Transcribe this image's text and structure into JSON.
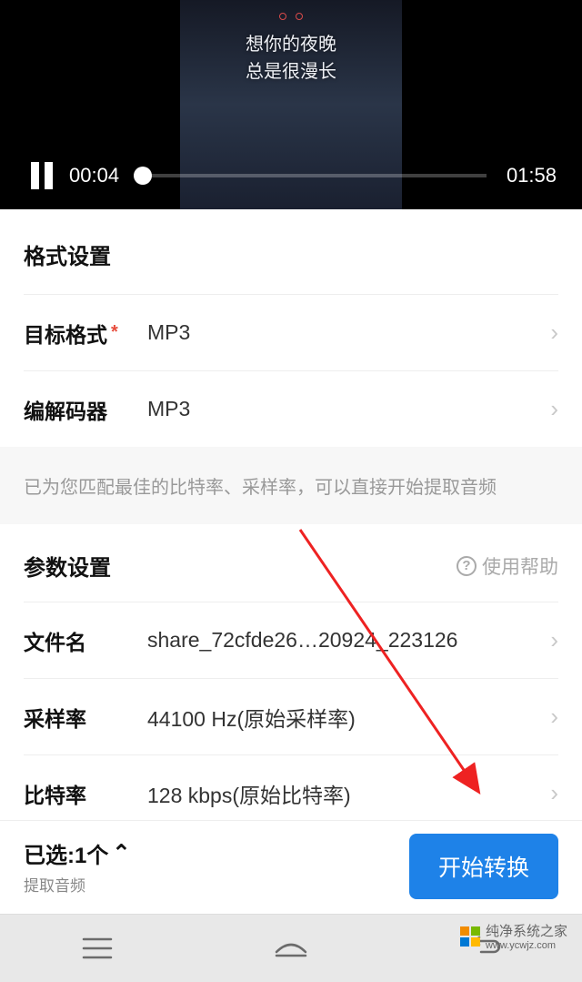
{
  "video": {
    "lyrics_line1": "想你的夜晚",
    "lyrics_line2": "总是很漫长",
    "current_time": "00:04",
    "duration": "01:58"
  },
  "format_section": {
    "title": "格式设置",
    "target_format": {
      "label": "目标格式",
      "value": "MP3",
      "required": true
    },
    "codec": {
      "label": "编解码器",
      "value": "MP3"
    }
  },
  "info_banner": "已为您匹配最佳的比特率、采样率，可以直接开始提取音频",
  "param_section": {
    "title": "参数设置",
    "help_label": "使用帮助",
    "filename": {
      "label": "文件名",
      "value": "share_72cfde26…20924_223126"
    },
    "sample_rate": {
      "label": "采样率",
      "value": "44100 Hz(原始采样率)"
    },
    "bitrate": {
      "label": "比特率",
      "value": "128 kbps(原始比特率)"
    }
  },
  "bottom": {
    "selected_label": "已选:1个",
    "sub_label": "提取音频",
    "convert_button": "开始转换"
  },
  "watermark": {
    "text": "纯净系统之家",
    "url": "www.ycwjz.com"
  }
}
